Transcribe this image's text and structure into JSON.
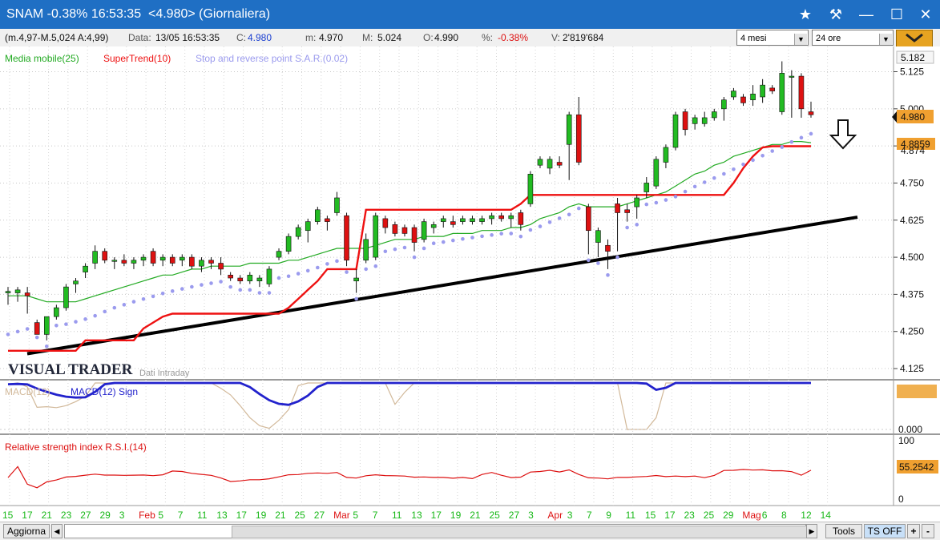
{
  "window": {
    "title": "SNAM -0.38% 16:53:35  <4.980> (Giornaliera)"
  },
  "infobar": {
    "ohl": "(m.4,97-M.5,024 A:4,99)",
    "data_label": "Data:",
    "data_value": "13/05 16:53:35",
    "c_label": "C:",
    "c_value": "4.980",
    "m_label": "m:",
    "m_value": "4.970",
    "M_label": "M:",
    "M_value": "5.024",
    "o_label": "O:",
    "o_value": "4.990",
    "pct_label": "%:",
    "pct_value": "-0.38%",
    "v_label": "V:",
    "v_value": "2'819'684",
    "period": "4 mesi",
    "interval": "24 ore"
  },
  "legend": {
    "ma": "Media mobile(25)",
    "supertrend": "SuperTrend(10)",
    "sar": "Stop and reverse point S.A.R.(0.02)",
    "macd": "MACD(12)",
    "macd_sign": "MACD(12) Sign",
    "rsi": "Relative strength index R.S.I.(14)"
  },
  "watermark": {
    "brand": "VISUAL TRADER",
    "sub": "Dati Intraday"
  },
  "price_axis": {
    "ticks": [
      "5.125",
      "5.000",
      "4.875",
      "4.750",
      "4.625",
      "4.500",
      "4.375",
      "4.250",
      "4.125"
    ],
    "top_box": "5.182",
    "last_box": "4.980",
    "ma_box": "4.8859",
    "st_box": "4.874"
  },
  "macd_axis": {
    "ticks": [
      "0.000"
    ]
  },
  "rsi_axis": {
    "ticks": [
      "100",
      "0"
    ],
    "value_box": "55.2542"
  },
  "x_axis": {
    "labels": [
      "15",
      "17",
      "21",
      "23",
      "27",
      "29",
      "3",
      "Feb",
      "5",
      "7",
      "11",
      "13",
      "17",
      "19",
      "21",
      "25",
      "27",
      "Mar",
      "5",
      "7",
      "11",
      "13",
      "17",
      "19",
      "21",
      "25",
      "27",
      "3",
      "Apr",
      "3",
      "7",
      "9",
      "11",
      "15",
      "17",
      "23",
      "25",
      "29",
      "Mag",
      "6",
      "8",
      "12",
      "14"
    ],
    "red": [
      "Feb",
      "Mar",
      "Apr",
      "Mag"
    ]
  },
  "bottom": {
    "refresh": "Aggiorna",
    "tools": "Tools",
    "ts": "TS OFF",
    "plus": "+",
    "minus": "-"
  },
  "colors": {
    "up": "#22bb22",
    "down": "#dd1111",
    "supertrend": "#ee1111",
    "ma": "#22aa22",
    "sar": "#9b9bee",
    "macd": "#d2b99a",
    "macd_sign": "#2222cc",
    "rsi": "#dd1111",
    "trendline": "#000000"
  },
  "chart_data": [
    {
      "type": "candlestick",
      "title": "SNAM (Giornaliera)",
      "ylim": [
        4.09,
        5.21
      ],
      "candles": [
        {
          "x": "15",
          "o": 4.38,
          "h": 4.4,
          "l": 4.34,
          "c": 4.385
        },
        {
          "x": "16",
          "o": 4.38,
          "h": 4.4,
          "l": 4.35,
          "c": 4.39
        },
        {
          "x": "17",
          "o": 4.38,
          "h": 4.4,
          "l": 4.31,
          "c": 4.37
        },
        {
          "x": "20",
          "o": 4.28,
          "h": 4.29,
          "l": 4.25,
          "c": 4.24
        },
        {
          "x": "21",
          "o": 4.24,
          "h": 4.3,
          "l": 4.22,
          "c": 4.3
        },
        {
          "x": "22",
          "o": 4.3,
          "h": 4.34,
          "l": 4.29,
          "c": 4.33
        },
        {
          "x": "23",
          "o": 4.33,
          "h": 4.41,
          "l": 4.32,
          "c": 4.4
        },
        {
          "x": "24",
          "o": 4.41,
          "h": 4.43,
          "l": 4.38,
          "c": 4.42
        },
        {
          "x": "27",
          "o": 4.45,
          "h": 4.48,
          "l": 4.43,
          "c": 4.47
        },
        {
          "x": "28",
          "o": 4.48,
          "h": 4.54,
          "l": 4.46,
          "c": 4.52
        },
        {
          "x": "29",
          "o": 4.52,
          "h": 4.53,
          "l": 4.48,
          "c": 4.49
        },
        {
          "x": "30",
          "o": 4.49,
          "h": 4.5,
          "l": 4.46,
          "c": 4.49
        },
        {
          "x": "31",
          "o": 4.49,
          "h": 4.51,
          "l": 4.47,
          "c": 4.48
        },
        {
          "x": "3",
          "o": 4.48,
          "h": 4.5,
          "l": 4.46,
          "c": 4.49
        },
        {
          "x": "4",
          "o": 4.49,
          "h": 4.51,
          "l": 4.47,
          "c": 4.5
        },
        {
          "x": "5",
          "o": 4.52,
          "h": 4.53,
          "l": 4.47,
          "c": 4.48
        },
        {
          "x": "6",
          "o": 4.49,
          "h": 4.51,
          "l": 4.47,
          "c": 4.5
        },
        {
          "x": "7",
          "o": 4.5,
          "h": 4.51,
          "l": 4.47,
          "c": 4.48
        },
        {
          "x": "10",
          "o": 4.49,
          "h": 4.51,
          "l": 4.47,
          "c": 4.5
        },
        {
          "x": "11",
          "o": 4.5,
          "h": 4.51,
          "l": 4.46,
          "c": 4.47
        },
        {
          "x": "12",
          "o": 4.47,
          "h": 4.5,
          "l": 4.45,
          "c": 4.49
        },
        {
          "x": "13",
          "o": 4.49,
          "h": 4.5,
          "l": 4.46,
          "c": 4.48
        },
        {
          "x": "14",
          "o": 4.48,
          "h": 4.5,
          "l": 4.44,
          "c": 4.46
        },
        {
          "x": "17",
          "o": 4.44,
          "h": 4.45,
          "l": 4.42,
          "c": 4.43
        },
        {
          "x": "18",
          "o": 4.43,
          "h": 4.44,
          "l": 4.41,
          "c": 4.42
        },
        {
          "x": "19",
          "o": 4.42,
          "h": 4.45,
          "l": 4.41,
          "c": 4.44
        },
        {
          "x": "20",
          "o": 4.42,
          "h": 4.44,
          "l": 4.4,
          "c": 4.43
        },
        {
          "x": "21",
          "o": 4.41,
          "h": 4.47,
          "l": 4.4,
          "c": 4.46
        },
        {
          "x": "24",
          "o": 4.5,
          "h": 4.53,
          "l": 4.49,
          "c": 4.52
        },
        {
          "x": "25",
          "o": 4.52,
          "h": 4.58,
          "l": 4.51,
          "c": 4.57
        },
        {
          "x": "26",
          "o": 4.57,
          "h": 4.61,
          "l": 4.56,
          "c": 4.6
        },
        {
          "x": "27",
          "o": 4.59,
          "h": 4.63,
          "l": 4.55,
          "c": 4.62
        },
        {
          "x": "28",
          "o": 4.62,
          "h": 4.67,
          "l": 4.61,
          "c": 4.66
        },
        {
          "x": "1",
          "o": 4.63,
          "h": 4.64,
          "l": 4.59,
          "c": 4.62
        },
        {
          "x": "2",
          "o": 4.65,
          "h": 4.72,
          "l": 4.64,
          "c": 4.7
        },
        {
          "x": "5",
          "o": 4.64,
          "h": 4.65,
          "l": 4.47,
          "c": 4.49
        },
        {
          "x": "6",
          "o": 4.42,
          "h": 4.46,
          "l": 4.38,
          "c": 4.43
        },
        {
          "x": "7",
          "o": 4.49,
          "h": 4.58,
          "l": 4.48,
          "c": 4.56
        },
        {
          "x": "8",
          "o": 4.5,
          "h": 4.65,
          "l": 4.49,
          "c": 4.64
        },
        {
          "x": "11",
          "o": 4.63,
          "h": 4.64,
          "l": 4.58,
          "c": 4.6
        },
        {
          "x": "12",
          "o": 4.61,
          "h": 4.62,
          "l": 4.57,
          "c": 4.58
        },
        {
          "x": "13",
          "o": 4.6,
          "h": 4.61,
          "l": 4.57,
          "c": 4.58
        },
        {
          "x": "14",
          "o": 4.6,
          "h": 4.61,
          "l": 4.52,
          "c": 4.55
        },
        {
          "x": "15",
          "o": 4.56,
          "h": 4.63,
          "l": 4.55,
          "c": 4.62
        },
        {
          "x": "18",
          "o": 4.6,
          "h": 4.62,
          "l": 4.58,
          "c": 4.61
        },
        {
          "x": "19",
          "o": 4.62,
          "h": 4.64,
          "l": 4.6,
          "c": 4.63
        },
        {
          "x": "20",
          "o": 4.62,
          "h": 4.64,
          "l": 4.6,
          "c": 4.61
        },
        {
          "x": "21",
          "o": 4.62,
          "h": 4.64,
          "l": 4.61,
          "c": 4.63
        },
        {
          "x": "22",
          "o": 4.62,
          "h": 4.64,
          "l": 4.61,
          "c": 4.63
        },
        {
          "x": "25",
          "o": 4.62,
          "h": 4.64,
          "l": 4.61,
          "c": 4.63
        },
        {
          "x": "26",
          "o": 4.63,
          "h": 4.65,
          "l": 4.61,
          "c": 4.64
        },
        {
          "x": "27",
          "o": 4.64,
          "h": 4.65,
          "l": 4.62,
          "c": 4.63
        },
        {
          "x": "28",
          "o": 4.63,
          "h": 4.65,
          "l": 4.6,
          "c": 4.64
        },
        {
          "x": "29",
          "o": 4.65,
          "h": 4.66,
          "l": 4.59,
          "c": 4.61
        },
        {
          "x": "2",
          "o": 4.68,
          "h": 4.79,
          "l": 4.67,
          "c": 4.78
        },
        {
          "x": "3",
          "o": 4.81,
          "h": 4.84,
          "l": 4.8,
          "c": 4.83
        },
        {
          "x": "4",
          "o": 4.8,
          "h": 4.84,
          "l": 4.78,
          "c": 4.83
        },
        {
          "x": "5",
          "o": 4.82,
          "h": 4.84,
          "l": 4.8,
          "c": 4.81
        },
        {
          "x": "8",
          "o": 4.88,
          "h": 4.99,
          "l": 4.76,
          "c": 4.98
        },
        {
          "x": "9",
          "o": 4.98,
          "h": 5.04,
          "l": 4.81,
          "c": 4.82
        },
        {
          "x": "10",
          "o": 4.67,
          "h": 4.68,
          "l": 4.51,
          "c": 4.59
        },
        {
          "x": "11",
          "o": 4.55,
          "h": 4.6,
          "l": 4.5,
          "c": 4.59
        },
        {
          "x": "12",
          "o": 4.54,
          "h": 4.56,
          "l": 4.46,
          "c": 4.52
        },
        {
          "x": "15",
          "o": 4.68,
          "h": 4.7,
          "l": 4.52,
          "c": 4.65
        },
        {
          "x": "16",
          "o": 4.66,
          "h": 4.68,
          "l": 4.62,
          "c": 4.65
        },
        {
          "x": "17",
          "o": 4.67,
          "h": 4.71,
          "l": 4.63,
          "c": 4.7
        },
        {
          "x": "18",
          "o": 4.72,
          "h": 4.77,
          "l": 4.7,
          "c": 4.75
        },
        {
          "x": "19",
          "o": 4.74,
          "h": 4.84,
          "l": 4.73,
          "c": 4.83
        },
        {
          "x": "23",
          "o": 4.82,
          "h": 4.88,
          "l": 4.8,
          "c": 4.87
        },
        {
          "x": "24",
          "o": 4.87,
          "h": 4.99,
          "l": 4.86,
          "c": 4.98
        },
        {
          "x": "25",
          "o": 4.99,
          "h": 5.0,
          "l": 4.91,
          "c": 4.93
        },
        {
          "x": "26",
          "o": 4.95,
          "h": 4.98,
          "l": 4.93,
          "c": 4.97
        },
        {
          "x": "29",
          "o": 4.95,
          "h": 4.99,
          "l": 4.94,
          "c": 4.97
        },
        {
          "x": "30",
          "o": 4.97,
          "h": 5.0,
          "l": 4.96,
          "c": 4.99
        },
        {
          "x": "2",
          "o": 5.0,
          "h": 5.04,
          "l": 4.96,
          "c": 5.03
        },
        {
          "x": "3",
          "o": 5.04,
          "h": 5.07,
          "l": 5.03,
          "c": 5.06
        },
        {
          "x": "6",
          "o": 5.04,
          "h": 5.05,
          "l": 5.01,
          "c": 5.02
        },
        {
          "x": "7",
          "o": 5.03,
          "h": 5.08,
          "l": 5.01,
          "c": 5.05
        },
        {
          "x": "8",
          "o": 5.04,
          "h": 5.1,
          "l": 5.02,
          "c": 5.08
        },
        {
          "x": "9",
          "o": 5.07,
          "h": 5.08,
          "l": 5.05,
          "c": 5.06
        },
        {
          "x": "10",
          "o": 4.99,
          "h": 5.16,
          "l": 4.98,
          "c": 5.12
        },
        {
          "x": "11",
          "o": 5.11,
          "h": 5.13,
          "l": 4.97,
          "c": 5.11
        },
        {
          "x": "12",
          "o": 5.11,
          "h": 5.12,
          "l": 4.97,
          "c": 5.0
        },
        {
          "x": "13",
          "o": 4.99,
          "h": 5.024,
          "l": 4.97,
          "c": 4.98
        }
      ],
      "series": [
        {
          "name": "Media mobile(25)",
          "values": [
            4.37,
            4.37,
            4.37,
            4.36,
            4.35,
            4.35,
            4.35,
            4.35,
            4.36,
            4.37,
            4.38,
            4.39,
            4.4,
            4.41,
            4.42,
            4.43,
            4.44,
            4.44,
            4.45,
            4.46,
            4.46,
            4.47,
            4.47,
            4.47,
            4.47,
            4.48,
            4.48,
            4.48,
            4.48,
            4.49,
            4.49,
            4.5,
            4.51,
            4.52,
            4.53,
            4.53,
            4.53,
            4.53,
            4.54,
            4.55,
            4.56,
            4.56,
            4.56,
            4.57,
            4.57,
            4.57,
            4.58,
            4.58,
            4.58,
            4.59,
            4.59,
            4.59,
            4.6,
            4.6,
            4.61,
            4.63,
            4.64,
            4.65,
            4.67,
            4.68,
            4.67,
            4.67,
            4.67,
            4.67,
            4.68,
            4.69,
            4.7,
            4.71,
            4.72,
            4.74,
            4.76,
            4.78,
            4.79,
            4.81,
            4.82,
            4.84,
            4.85,
            4.86,
            4.87,
            4.88,
            4.88,
            4.89,
            4.89,
            4.886
          ]
        },
        {
          "name": "SuperTrend(10)",
          "values": [
            4.185,
            4.185,
            4.185,
            4.185,
            4.185,
            4.185,
            4.185,
            4.185,
            4.22,
            4.22,
            4.22,
            4.22,
            4.22,
            4.22,
            4.26,
            4.28,
            4.3,
            4.31,
            4.31,
            4.31,
            4.31,
            4.31,
            4.31,
            4.31,
            4.31,
            4.31,
            4.31,
            4.31,
            4.31,
            4.33,
            4.36,
            4.39,
            4.42,
            4.46,
            4.46,
            4.46,
            4.46,
            4.66,
            4.66,
            4.66,
            4.66,
            4.66,
            4.66,
            4.66,
            4.66,
            4.66,
            4.66,
            4.66,
            4.66,
            4.66,
            4.66,
            4.66,
            4.66,
            4.68,
            4.71,
            4.71,
            4.71,
            4.71,
            4.71,
            4.71,
            4.71,
            4.71,
            4.71,
            4.71,
            4.71,
            4.71,
            4.71,
            4.71,
            4.71,
            4.71,
            4.71,
            4.71,
            4.71,
            4.71,
            4.71,
            4.75,
            4.8,
            4.84,
            4.87,
            4.874,
            4.874,
            4.874,
            4.874,
            4.874
          ]
        },
        {
          "name": "Stop and reverse point S.A.R.(0.02)",
          "values": []
        }
      ],
      "annotations": [
        "trendline (support)",
        "down arrow"
      ]
    },
    {
      "type": "line",
      "title": "MACD(12)",
      "series": [
        {
          "name": "MACD(12)",
          "values": []
        },
        {
          "name": "MACD(12) Sign",
          "values": []
        }
      ]
    },
    {
      "type": "line",
      "title": "Relative strength index R.S.I.(14)",
      "ylim": [
        0,
        100
      ],
      "series": [
        {
          "name": "Relative strength index R.S.I.(14)",
          "last": 55.2542
        }
      ]
    }
  ]
}
